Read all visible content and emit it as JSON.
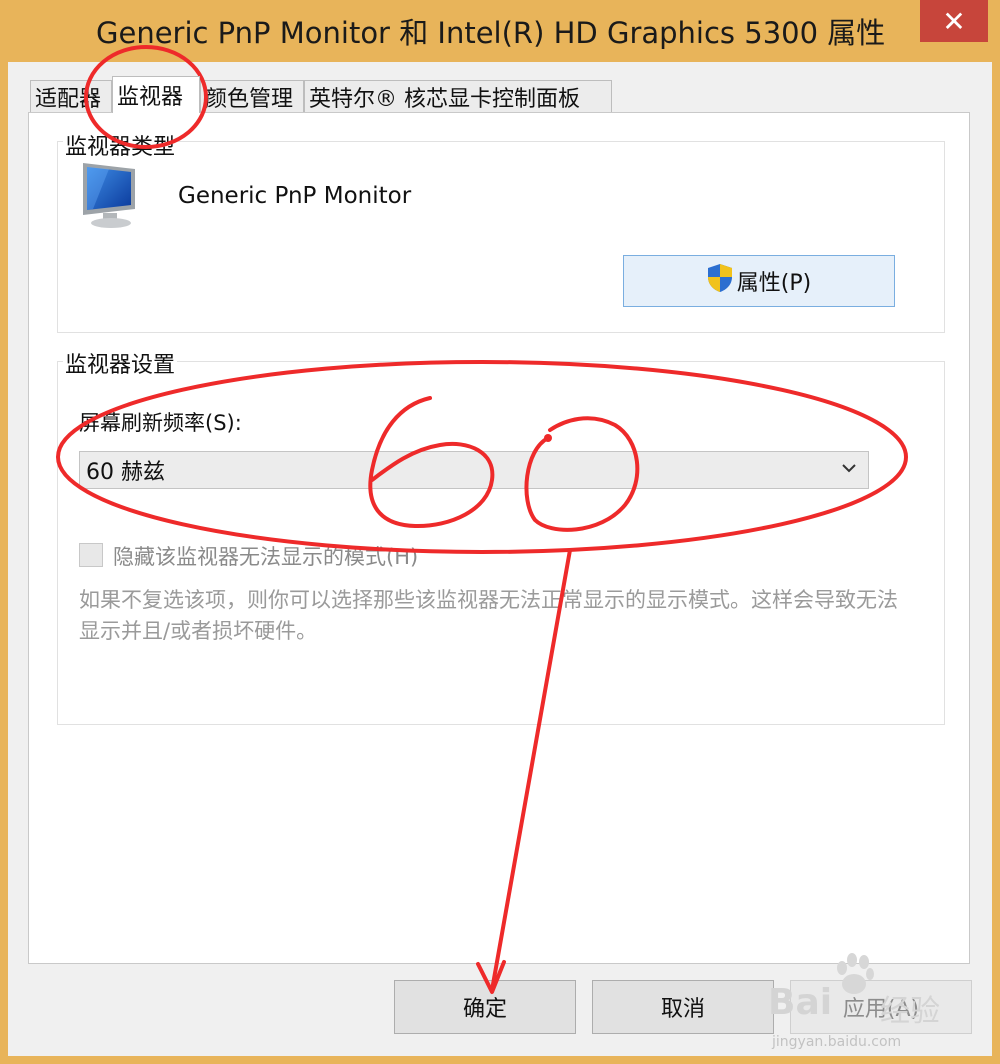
{
  "window": {
    "title": "Generic PnP Monitor 和 Intel(R) HD Graphics 5300 属性",
    "close_glyph": "✕"
  },
  "tabs": [
    {
      "label": "适配器",
      "active": false
    },
    {
      "label": "监视器",
      "active": true
    },
    {
      "label": "颜色管理",
      "active": false
    },
    {
      "label": "英特尔® 核芯显卡控制面板",
      "active": false
    }
  ],
  "monitor_type": {
    "group_label": "监视器类型",
    "monitor_name": "Generic PnP Monitor",
    "properties_button": "属性(P)"
  },
  "monitor_settings": {
    "group_label": "监视器设置",
    "refresh_label": "屏幕刷新频率(S):",
    "refresh_value": "60 赫兹",
    "hide_modes_label": "隐藏该监视器无法显示的模式(H)",
    "hide_modes_checked": false,
    "description": "如果不复选该项，则你可以选择那些该监视器无法正常显示的显示模式。这样会导致无法显示并且/或者损坏硬件。"
  },
  "buttons": {
    "ok": "确定",
    "cancel": "取消",
    "apply": "应用(A)"
  },
  "annotation": {
    "handwritten_text": "60",
    "color": "#ee2a2a"
  },
  "watermark": {
    "brand": "Bai",
    "brand_suffix": "经验",
    "url": "jingyan.baidu.com"
  },
  "colors": {
    "window_border": "#e8b45a",
    "close_button": "#c7453b",
    "accent_button": "#e6f0fa"
  }
}
